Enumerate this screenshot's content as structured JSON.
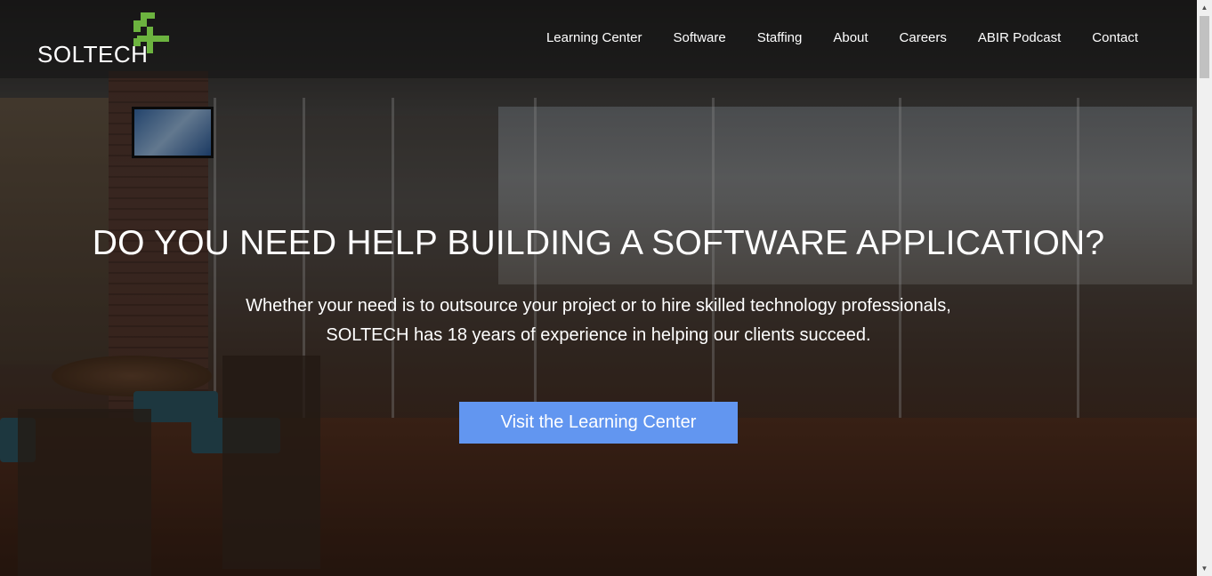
{
  "header": {
    "logo_text": "SOLTECH",
    "nav": [
      {
        "label": "Learning Center"
      },
      {
        "label": "Software"
      },
      {
        "label": "Staffing"
      },
      {
        "label": "About"
      },
      {
        "label": "Careers"
      },
      {
        "label": "ABIR Podcast"
      },
      {
        "label": "Contact"
      }
    ]
  },
  "hero": {
    "headline": "DO YOU NEED HELP BUILDING A SOFTWARE APPLICATION?",
    "subtext_line1": "Whether your need is to outsource your project or to hire skilled technology professionals,",
    "subtext_line2": "SOLTECH has 18 years of experience in helping our clients succeed.",
    "cta_label": "Visit the Learning Center"
  },
  "colors": {
    "accent": "#6296f0",
    "logo_green": "#6cb33f"
  },
  "icons": {
    "logo_mark": "soltech-s-plus-logo-icon",
    "scroll_up": "triangle-up-icon",
    "scroll_down": "triangle-down-icon"
  }
}
